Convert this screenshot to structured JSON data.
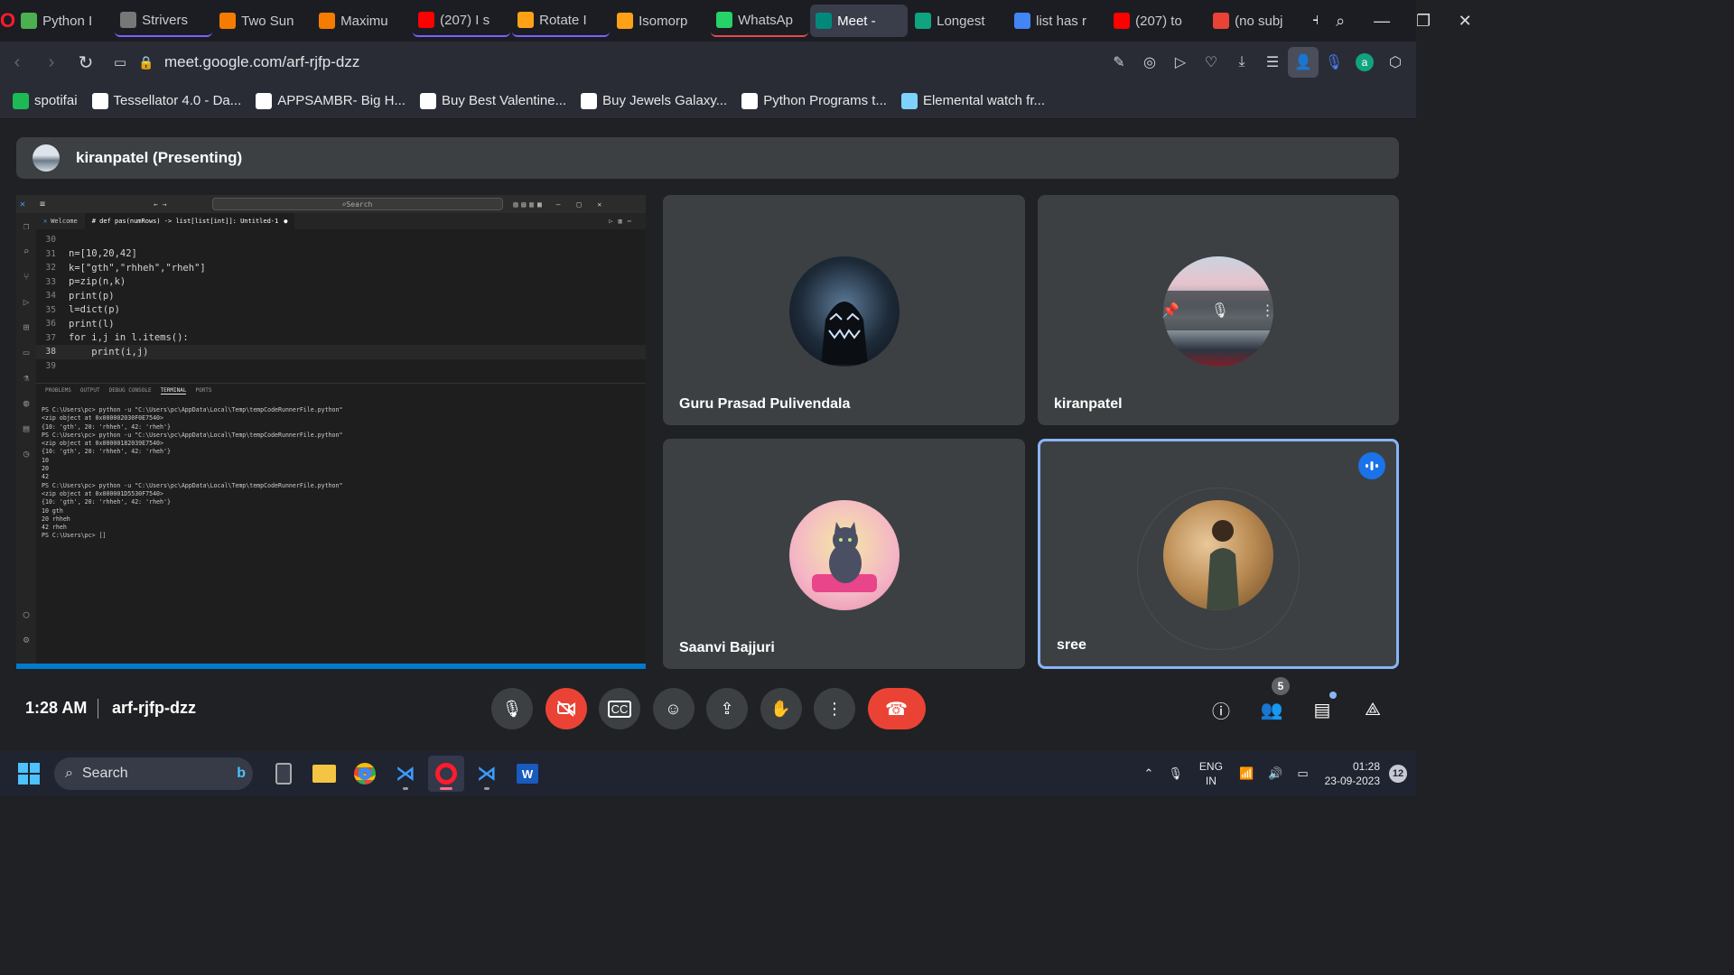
{
  "browser": {
    "tabs": [
      {
        "label": "Python I",
        "color": "#4caf50",
        "group": ""
      },
      {
        "label": "Strivers",
        "color": "#777",
        "group": "grp1"
      },
      {
        "label": "Two Sun",
        "color": "#f57c00",
        "group": ""
      },
      {
        "label": "Maximu",
        "color": "#f57c00",
        "group": ""
      },
      {
        "label": "(207) I s",
        "color": "#ff0000",
        "group": "grp1"
      },
      {
        "label": "Rotate I",
        "color": "#ffa116",
        "group": "grp1"
      },
      {
        "label": "Isomorp",
        "color": "#ffa116",
        "group": ""
      },
      {
        "label": "WhatsAp",
        "color": "#25d366",
        "group": "grp2"
      },
      {
        "label": "Meet - ",
        "color": "#00897b",
        "group": "active"
      },
      {
        "label": "Longest",
        "color": "#10a37f",
        "group": ""
      },
      {
        "label": "list has r",
        "color": "#4285f4",
        "group": ""
      },
      {
        "label": "(207) to",
        "color": "#ff0000",
        "group": ""
      },
      {
        "label": "(no subj",
        "color": "#ea4335",
        "group": ""
      }
    ],
    "url": "meet.google.com/arf-rjfp-dzz",
    "bookmarks": [
      {
        "label": "spotifai",
        "color": "#1db954"
      },
      {
        "label": "Tessellator 4.0 - Da...",
        "color": "#fff"
      },
      {
        "label": "APPSAMBR- Big H...",
        "color": "#fff"
      },
      {
        "label": "Buy Best Valentine...",
        "color": "#fff"
      },
      {
        "label": "Buy Jewels Galaxy...",
        "color": "#fff"
      },
      {
        "label": "Python Programs t...",
        "color": "#fff"
      },
      {
        "label": "Elemental watch fr...",
        "color": "#7dd3fc"
      }
    ]
  },
  "meet": {
    "presenter_title": "kiranpatel (Presenting)",
    "participants": [
      {
        "name": "Guru Prasad Pulivendala"
      },
      {
        "name": "kiranpatel"
      },
      {
        "name": "Saanvi Bajjuri"
      },
      {
        "name": "sree"
      }
    ],
    "time": "1:28 AM",
    "meeting_code": "arf-rjfp-dzz",
    "people_count": "5"
  },
  "vscode": {
    "search_placeholder": "Search",
    "tab_welcome": "Welcome",
    "tab_file": "# def pas(numRows) -> list[list[int]]: Untitled-1",
    "panel_tabs": [
      "PROBLEMS",
      "OUTPUT",
      "DEBUG CONSOLE",
      "TERMINAL",
      "PORTS"
    ],
    "code_lines": [
      {
        "n": "30",
        "t": ""
      },
      {
        "n": "31",
        "t": "n=[10,20,42]"
      },
      {
        "n": "32",
        "t": "k=[\"gth\",\"rhheh\",\"rheh\"]"
      },
      {
        "n": "33",
        "t": "p=zip(n,k)"
      },
      {
        "n": "34",
        "t": "print(p)"
      },
      {
        "n": "35",
        "t": "l=dict(p)"
      },
      {
        "n": "36",
        "t": "print(l)"
      },
      {
        "n": "37",
        "t": "for i,j in l.items():"
      },
      {
        "n": "38",
        "t": "    print(i,j)"
      },
      {
        "n": "39",
        "t": ""
      }
    ],
    "terminal": "PS C:\\Users\\pc> python -u \"C:\\Users\\pc\\AppData\\Local\\Temp\\tempCodeRunnerFile.python\"\n<zip object at 0x000002030F0E7540>\n{10: 'gth', 20: 'rhheh', 42: 'rheh'}\nPS C:\\Users\\pc> python -u \"C:\\Users\\pc\\AppData\\Local\\Temp\\tempCodeRunnerFile.python\"\n<zip object at 0x00000182039E7540>\n{10: 'gth', 20: 'rhheh', 42: 'rheh'}\n10\n20\n42\nPS C:\\Users\\pc> python -u \"C:\\Users\\pc\\AppData\\Local\\Temp\\tempCodeRunnerFile.python\"\n<zip object at 0x000001D5530F7540>\n{10: 'gth', 20: 'rhheh', 42: 'rheh'}\n10 gth\n20 rhheh\n42 rheh\nPS C:\\Users\\pc> []"
  },
  "taskbar": {
    "search_label": "Search",
    "lang_top": "ENG",
    "lang_bottom": "IN",
    "time": "01:28",
    "date": "23-09-2023",
    "notifications": "12"
  }
}
